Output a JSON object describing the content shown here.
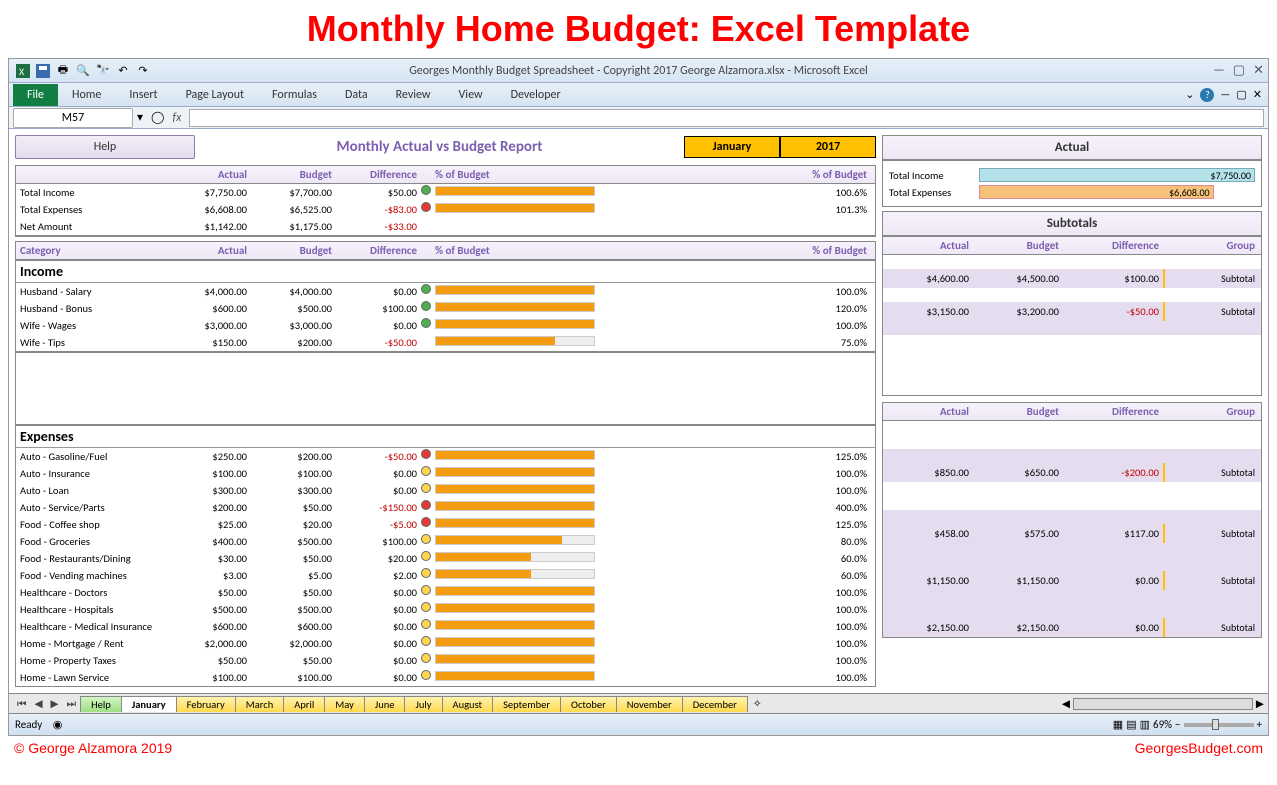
{
  "page_title": "Monthly Home Budget: Excel Template",
  "window_title": "Georges Monthly Budget Spreadsheet - Copyright 2017 George Alzamora.xlsx  -  Microsoft Excel",
  "ribbon": {
    "file": "File",
    "tabs": [
      "Home",
      "Insert",
      "Page Layout",
      "Formulas",
      "Data",
      "Review",
      "View",
      "Developer"
    ]
  },
  "name_box": "M57",
  "formula_value": "",
  "help_button": "Help",
  "report_title": "Monthly Actual vs Budget Report",
  "period": {
    "month": "January",
    "year": "2017"
  },
  "summary_headers": {
    "cat": "",
    "actual": "Actual",
    "budget": "Budget",
    "difference": "Difference",
    "pctbar": "% of Budget",
    "pct": "% of Budget"
  },
  "category_headers": {
    "cat": "Category",
    "actual": "Actual",
    "budget": "Budget",
    "difference": "Difference",
    "pctbar": "% of Budget",
    "pct": "% of Budget"
  },
  "summary": [
    {
      "label": "Total Income",
      "actual": "$7,750.00",
      "budget": "$7,700.00",
      "difference": "$50.00",
      "diff_neg": false,
      "ind": "g",
      "bar": 100,
      "pct": "100.6%"
    },
    {
      "label": "Total Expenses",
      "actual": "$6,608.00",
      "budget": "$6,525.00",
      "difference": "-$83.00",
      "diff_neg": true,
      "ind": "r",
      "bar": 100,
      "pct": "101.3%"
    },
    {
      "label": "Net Amount",
      "actual": "$1,142.00",
      "budget": "$1,175.00",
      "difference": "-$33.00",
      "diff_neg": true,
      "ind": "",
      "bar": null,
      "pct": ""
    }
  ],
  "income_title": "Income",
  "income": [
    {
      "label": "Husband - Salary",
      "actual": "$4,000.00",
      "budget": "$4,000.00",
      "difference": "$0.00",
      "diff_neg": false,
      "ind": "g",
      "bar": 100,
      "pct": "100.0%"
    },
    {
      "label": "Husband - Bonus",
      "actual": "$600.00",
      "budget": "$500.00",
      "difference": "$100.00",
      "diff_neg": false,
      "ind": "g",
      "bar": 100,
      "pct": "120.0%"
    },
    {
      "label": "Wife - Wages",
      "actual": "$3,000.00",
      "budget": "$3,000.00",
      "difference": "$0.00",
      "diff_neg": false,
      "ind": "g",
      "bar": 100,
      "pct": "100.0%"
    },
    {
      "label": "Wife - Tips",
      "actual": "$150.00",
      "budget": "$200.00",
      "difference": "-$50.00",
      "diff_neg": true,
      "ind": "",
      "bar": 75,
      "pct": "75.0%"
    }
  ],
  "expenses_title": "Expenses",
  "expenses": [
    {
      "label": "Auto - Gasoline/Fuel",
      "actual": "$250.00",
      "budget": "$200.00",
      "difference": "-$50.00",
      "diff_neg": true,
      "ind": "r",
      "bar": 100,
      "pct": "125.0%"
    },
    {
      "label": "Auto - Insurance",
      "actual": "$100.00",
      "budget": "$100.00",
      "difference": "$0.00",
      "diff_neg": false,
      "ind": "y",
      "bar": 100,
      "pct": "100.0%"
    },
    {
      "label": "Auto - Loan",
      "actual": "$300.00",
      "budget": "$300.00",
      "difference": "$0.00",
      "diff_neg": false,
      "ind": "y",
      "bar": 100,
      "pct": "100.0%"
    },
    {
      "label": "Auto - Service/Parts",
      "actual": "$200.00",
      "budget": "$50.00",
      "difference": "-$150.00",
      "diff_neg": true,
      "ind": "r",
      "bar": 100,
      "pct": "400.0%"
    },
    {
      "label": "Food - Coffee shop",
      "actual": "$25.00",
      "budget": "$20.00",
      "difference": "-$5.00",
      "diff_neg": true,
      "ind": "r",
      "bar": 100,
      "pct": "125.0%"
    },
    {
      "label": "Food - Groceries",
      "actual": "$400.00",
      "budget": "$500.00",
      "difference": "$100.00",
      "diff_neg": false,
      "ind": "y",
      "bar": 80,
      "pct": "80.0%"
    },
    {
      "label": "Food - Restaurants/Dining",
      "actual": "$30.00",
      "budget": "$50.00",
      "difference": "$20.00",
      "diff_neg": false,
      "ind": "y",
      "bar": 60,
      "pct": "60.0%"
    },
    {
      "label": "Food - Vending machines",
      "actual": "$3.00",
      "budget": "$5.00",
      "difference": "$2.00",
      "diff_neg": false,
      "ind": "y",
      "bar": 60,
      "pct": "60.0%"
    },
    {
      "label": "Healthcare - Doctors",
      "actual": "$50.00",
      "budget": "$50.00",
      "difference": "$0.00",
      "diff_neg": false,
      "ind": "y",
      "bar": 100,
      "pct": "100.0%"
    },
    {
      "label": "Healthcare - Hospitals",
      "actual": "$500.00",
      "budget": "$500.00",
      "difference": "$0.00",
      "diff_neg": false,
      "ind": "y",
      "bar": 100,
      "pct": "100.0%"
    },
    {
      "label": "Healthcare - Medical Insurance",
      "actual": "$600.00",
      "budget": "$600.00",
      "difference": "$0.00",
      "diff_neg": false,
      "ind": "y",
      "bar": 100,
      "pct": "100.0%"
    },
    {
      "label": "Home - Mortgage / Rent",
      "actual": "$2,000.00",
      "budget": "$2,000.00",
      "difference": "$0.00",
      "diff_neg": false,
      "ind": "y",
      "bar": 100,
      "pct": "100.0%"
    },
    {
      "label": "Home - Property Taxes",
      "actual": "$50.00",
      "budget": "$50.00",
      "difference": "$0.00",
      "diff_neg": false,
      "ind": "y",
      "bar": 100,
      "pct": "100.0%"
    },
    {
      "label": "Home - Lawn Service",
      "actual": "$100.00",
      "budget": "$100.00",
      "difference": "$0.00",
      "diff_neg": false,
      "ind": "y",
      "bar": 100,
      "pct": "100.0%"
    }
  ],
  "right": {
    "actual_title": "Actual",
    "total_income_label": "Total Income",
    "total_income_value": "$7,750.00",
    "total_expenses_label": "Total Expenses",
    "total_expenses_value": "$6,608.00",
    "subtotals_title": "Subtotals",
    "sub_headers": {
      "actual": "Actual",
      "budget": "Budget",
      "difference": "Difference",
      "group": "Group"
    },
    "income_subs": [
      {
        "actual": "$4,600.00",
        "budget": "$4,500.00",
        "difference": "$100.00",
        "diff_neg": false,
        "group": "Subtotal"
      },
      {
        "actual": "$3,150.00",
        "budget": "$3,200.00",
        "difference": "-$50.00",
        "diff_neg": true,
        "group": "Subtotal"
      }
    ],
    "expense_subs": [
      {
        "actual": "$850.00",
        "budget": "$650.00",
        "difference": "-$200.00",
        "diff_neg": true,
        "group": "Subtotal"
      },
      {
        "actual": "$458.00",
        "budget": "$575.00",
        "difference": "$117.00",
        "diff_neg": false,
        "group": "Subtotal"
      },
      {
        "actual": "$1,150.00",
        "budget": "$1,150.00",
        "difference": "$0.00",
        "diff_neg": false,
        "group": "Subtotal"
      },
      {
        "actual": "$2,150.00",
        "budget": "$2,150.00",
        "difference": "$0.00",
        "diff_neg": false,
        "group": "Subtotal"
      }
    ]
  },
  "sheet_tabs": [
    "Help",
    "January",
    "February",
    "March",
    "April",
    "May",
    "June",
    "July",
    "August",
    "September",
    "October",
    "November",
    "December"
  ],
  "status": {
    "ready": "Ready",
    "zoom": "69%"
  },
  "footer": {
    "copyright": "© George Alzamora 2019",
    "site": "GeorgesBudget.com"
  },
  "chart_data": {
    "type": "bar",
    "title": "Actual",
    "series": [
      {
        "name": "Total Income",
        "value": 7750,
        "color": "#b5e1e8"
      },
      {
        "name": "Total Expenses",
        "value": 6608,
        "color": "#f6c27a"
      }
    ],
    "xlim": [
      0,
      8000
    ]
  }
}
